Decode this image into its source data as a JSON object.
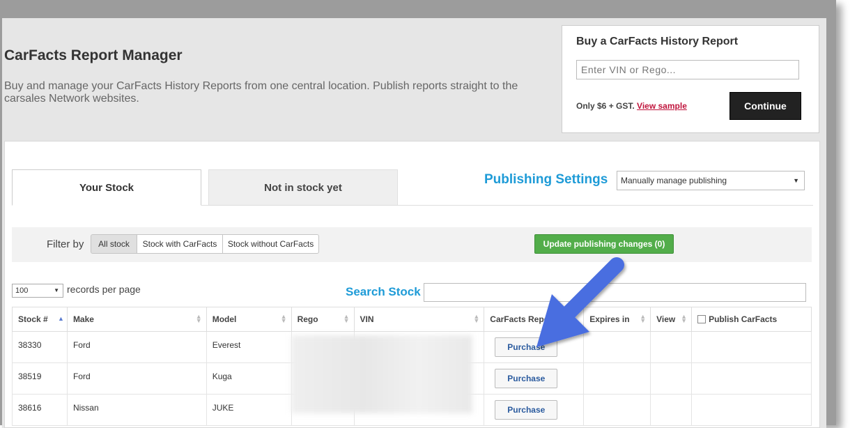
{
  "header": {
    "title": "CarFacts Report Manager",
    "description": "Buy and manage your CarFacts History Reports from one central location. Publish reports straight to the carsales Network websites."
  },
  "buy_box": {
    "title": "Buy a CarFacts History Report",
    "input_placeholder": "Enter VIN or Rego...",
    "price_note": "Only $6 + GST.",
    "view_sample": "View sample",
    "continue_label": "Continue"
  },
  "tabs": [
    {
      "label": "Your Stock",
      "active": true
    },
    {
      "label": "Not in stock yet",
      "active": false
    }
  ],
  "publishing": {
    "label": "Publishing Settings",
    "selected": "Manually manage publishing"
  },
  "filter": {
    "label": "Filter by",
    "options": [
      "All stock",
      "Stock with CarFacts",
      "Stock without CarFacts"
    ],
    "selected": "All stock",
    "update_label": "Update publishing changes (0)"
  },
  "records": {
    "value": "100",
    "label": "records per page"
  },
  "search": {
    "label": "Search Stock"
  },
  "table": {
    "headers": [
      "Stock #",
      "Make",
      "Model",
      "Rego",
      "VIN",
      "CarFacts Report",
      "Expires in",
      "View",
      "Publish CarFacts"
    ],
    "rows": [
      {
        "stock": "38330",
        "make": "Ford",
        "model": "Everest",
        "action": "Purchase"
      },
      {
        "stock": "38519",
        "make": "Ford",
        "model": "Kuga",
        "action": "Purchase"
      },
      {
        "stock": "38616",
        "make": "Nissan",
        "model": "JUKE",
        "action": "Purchase"
      }
    ]
  },
  "colors": {
    "accent_blue": "#1e9bd7",
    "update_green": "#52ad4a",
    "arrow_blue": "#4a6ee0",
    "link_red": "#c0143c"
  }
}
